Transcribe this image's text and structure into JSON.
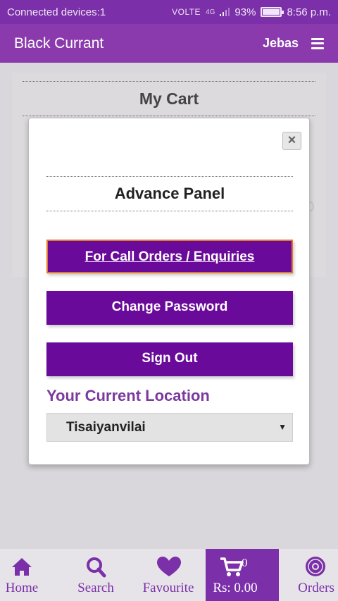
{
  "status_bar": {
    "left_text": "Connected devices:1",
    "network": "VOLTE",
    "signal_label": "4G",
    "battery_percent": "93%",
    "battery_level": 0.93,
    "time": "8:56 p.m."
  },
  "app_bar": {
    "title": "Black Currant",
    "user_name": "Jebas"
  },
  "background_page": {
    "cart_title": "My Cart"
  },
  "modal": {
    "close_glyph": "×",
    "title": "Advance Panel",
    "call_orders_label": "For Call Orders / Enquiries",
    "change_password_label": "Change Password",
    "sign_out_label": "Sign Out",
    "location_label": "Your Current Location",
    "location_selected": "Tisaiyanvilai"
  },
  "bottom_nav": {
    "items": [
      {
        "label": "Home",
        "icon": "home-icon"
      },
      {
        "label": "Search",
        "icon": "search-icon"
      },
      {
        "label": "Favourite",
        "icon": "heart-icon"
      },
      {
        "label": "Rs: 0.00",
        "icon": "cart-icon",
        "count": "0"
      },
      {
        "label": "Orders",
        "icon": "orders-badge-icon"
      }
    ]
  },
  "colors": {
    "primary": "#8b3aad",
    "button": "#6a0a9a",
    "accent_border": "#e27a2e",
    "location_label": "#7b3aa0"
  }
}
